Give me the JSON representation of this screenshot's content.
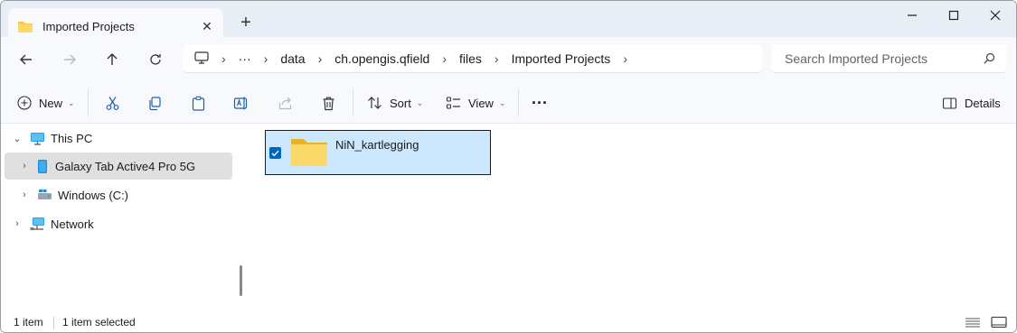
{
  "tab": {
    "title": "Imported Projects",
    "close_label": "✕",
    "new_tab_label": "+"
  },
  "window_controls": {
    "minimize": "—",
    "maximize": "☐",
    "close": "✕"
  },
  "address": {
    "overflow": "···",
    "crumbs": [
      "data",
      "ch.opengis.qfield",
      "files",
      "Imported Projects"
    ]
  },
  "search": {
    "placeholder": "Search Imported Projects"
  },
  "toolbar": {
    "new_label": "New",
    "sort_label": "Sort",
    "view_label": "View",
    "more_label": "···",
    "details_label": "Details"
  },
  "sidebar": {
    "items": [
      {
        "label": "This PC"
      },
      {
        "label": "Galaxy Tab Active4 Pro 5G"
      },
      {
        "label": "Windows (C:)"
      },
      {
        "label": "Network"
      }
    ]
  },
  "content": {
    "items": [
      {
        "name": "NiN_kartlegging",
        "selected": true
      }
    ]
  },
  "status": {
    "item_count": "1 item",
    "selected_count": "1 item selected"
  },
  "colors": {
    "accent": "#0067c0",
    "selection": "#cce8ff",
    "folder": "#f5c842",
    "chrome": "#e8eef6"
  }
}
